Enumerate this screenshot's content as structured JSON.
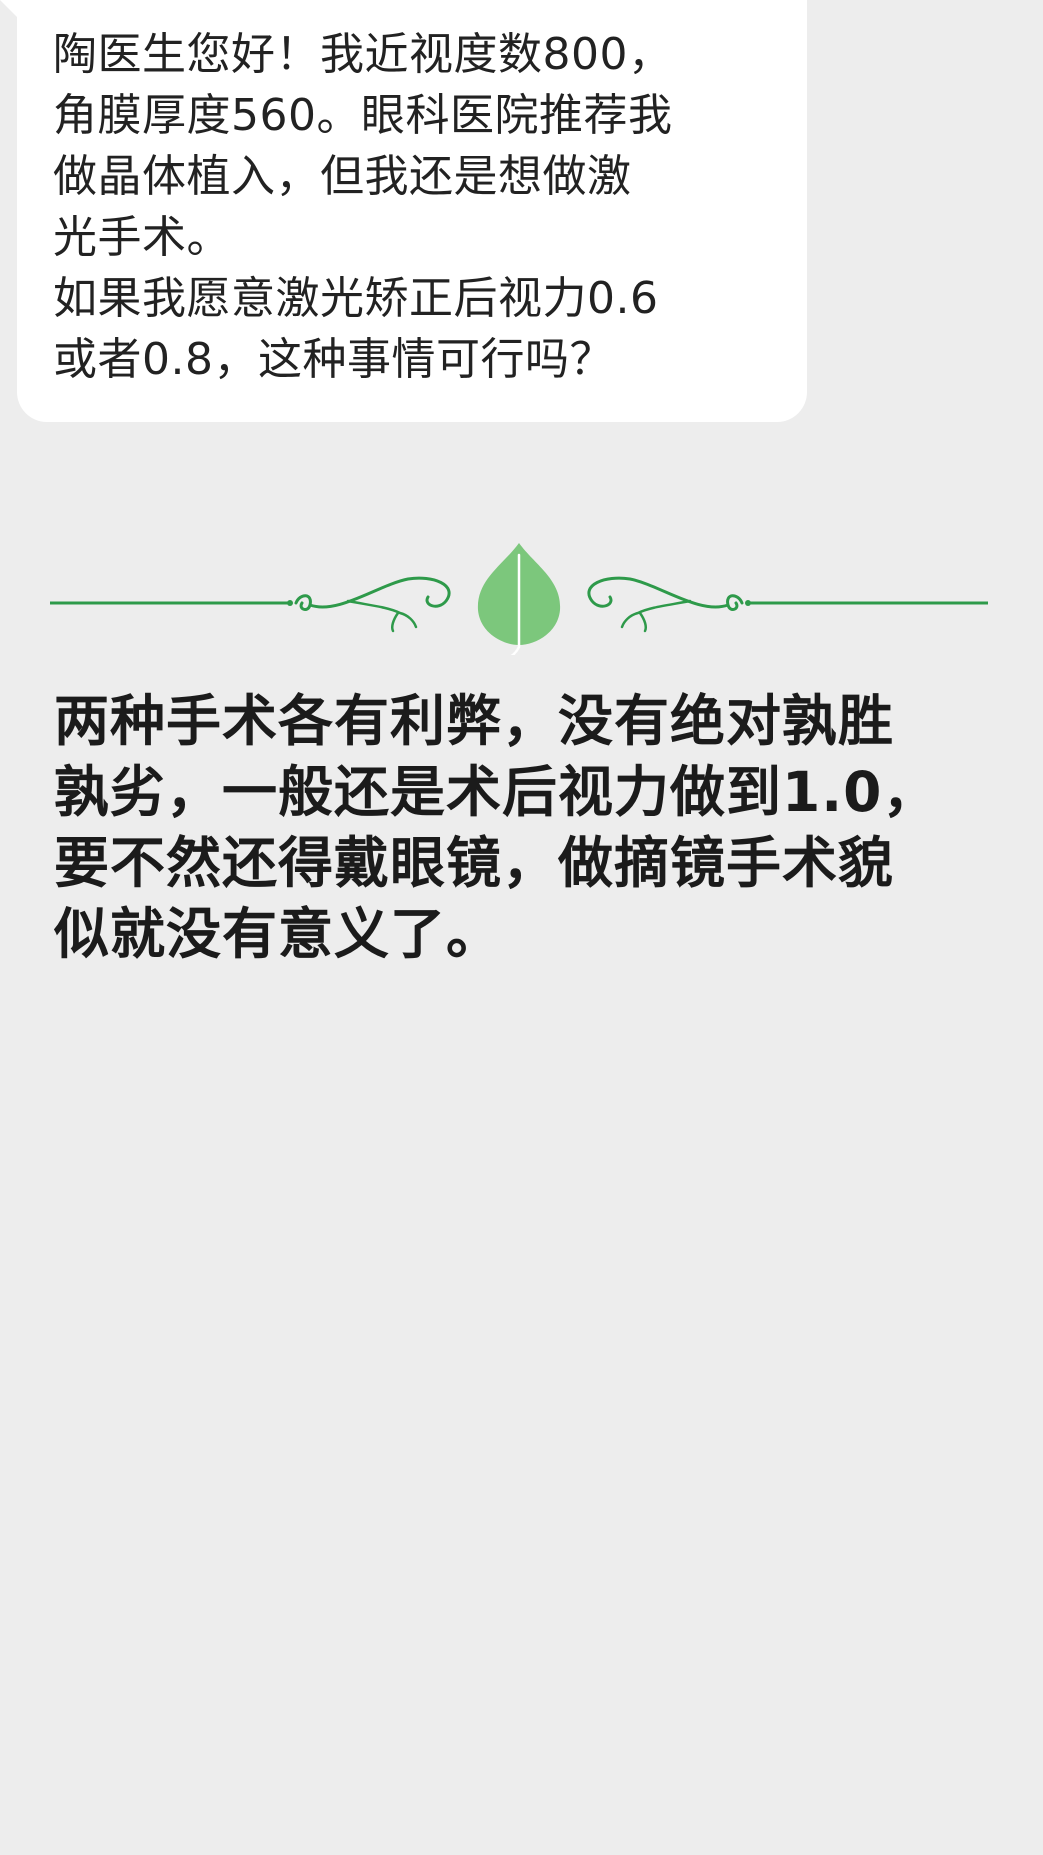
{
  "question": {
    "text": "陶医生您好！我近视度数800，\n角膜厚度560。眼科医院推荐我\n做晶体植入，但我还是想做激\n光手术。\n如果我愿意激光矫正后视力0.6\n或者0.8，这种事情可行吗？"
  },
  "divider": {
    "icon": "leaf-icon",
    "line_color": "#2e9a4a",
    "leaf_color": "#7cc77c"
  },
  "reply": {
    "text": "两种手术各有利弊，没有绝对孰胜\n孰劣，一般还是术后视力做到1.0，\n要不然还得戴眼镜，做摘镜手术貌\n似就没有意义了。"
  }
}
